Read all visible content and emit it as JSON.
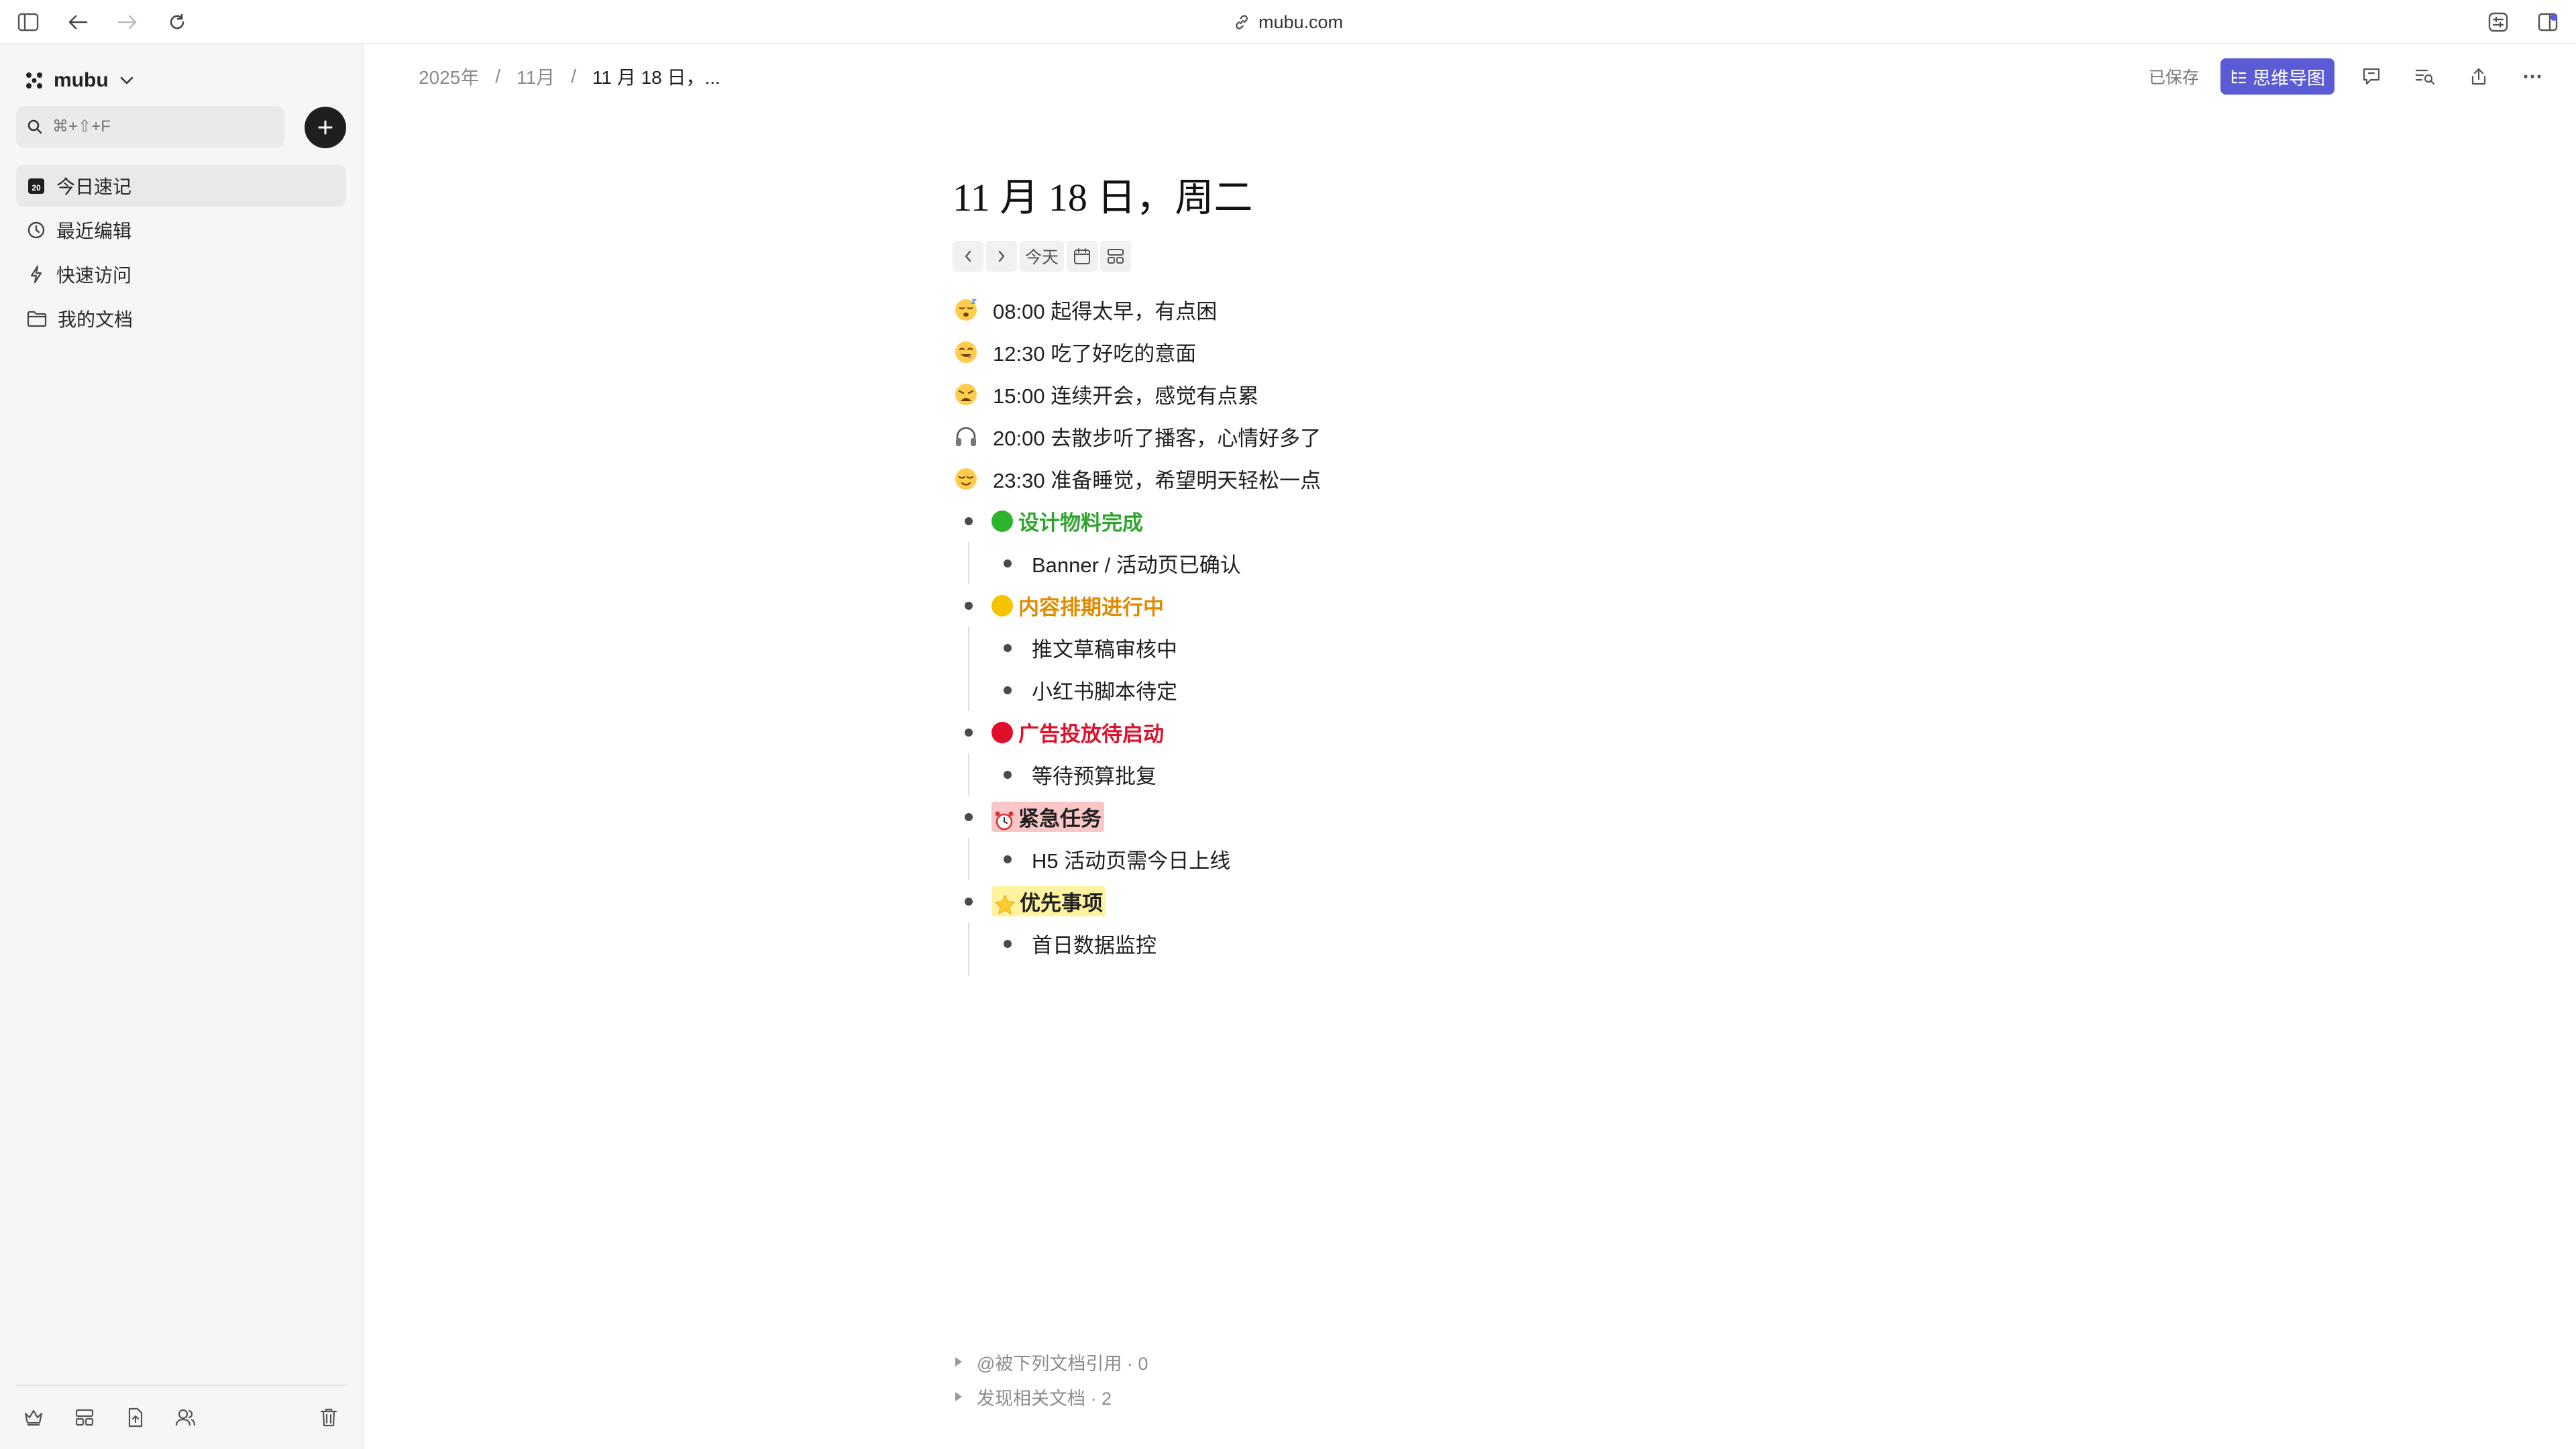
{
  "browser": {
    "url": "mubu.com"
  },
  "sidebar": {
    "brand": "mubu",
    "search_placeholder": "⌘+⇧+F",
    "items": [
      {
        "label": "今日速记",
        "icon": "calendar-icon",
        "active": true
      },
      {
        "label": "最近编辑",
        "icon": "clock-icon"
      },
      {
        "label": "快速访问",
        "icon": "bolt-icon"
      },
      {
        "label": "我的文档",
        "icon": "folder-icon"
      }
    ],
    "calendar_day": "20"
  },
  "header": {
    "breadcrumb": [
      "2025年",
      "11月",
      "11 月 18 日，..."
    ],
    "separator": "/",
    "saved": "已保存",
    "mindmap_label": "思维导图"
  },
  "doc": {
    "title": "11 月 18 日，周二",
    "today_label": "今天",
    "entries": [
      {
        "emoji": "sleepy-face-icon",
        "text": "08:00 起得太早，有点困"
      },
      {
        "emoji": "yum-face-icon",
        "text": "12:30 吃了好吃的意面"
      },
      {
        "emoji": "weary-face-icon",
        "text": "15:00 连续开会，感觉有点累"
      },
      {
        "emoji": "headphones-icon",
        "text": "20:00 去散步听了播客，心情好多了"
      },
      {
        "emoji": "relieved-face-icon",
        "text": "23:30 准备睡觉，希望明天轻松一点"
      }
    ],
    "tasks": [
      {
        "title": "设计物料完成",
        "color": "#2da52d",
        "marker": "green-circle-icon",
        "children": [
          "Banner / 活动页已确认"
        ]
      },
      {
        "title": "内容排期进行中",
        "color": "#e08a00",
        "marker": "yellow-circle-icon",
        "children": [
          "推文草稿审核中",
          "小红书脚本待定"
        ]
      },
      {
        "title": "广告投放待启动",
        "color": "#e0102a",
        "marker": "red-circle-icon",
        "children": [
          "等待预算批复"
        ]
      },
      {
        "title": "紧急任务",
        "color": "#1f1f1f",
        "marker": "alarm-clock-icon",
        "highlight": "#f9c7c7",
        "children": [
          "H5 活动页需今日上线"
        ]
      },
      {
        "title": "优先事项",
        "color": "#1f1f1f",
        "marker": "star-icon",
        "highlight": "#fff3a0",
        "children": [
          "首日数据监控"
        ]
      }
    ],
    "refs": [
      "@被下列文档引用 · 0",
      "发现相关文档 · 2"
    ]
  },
  "colors": {
    "accent": "#5b5bd6"
  }
}
